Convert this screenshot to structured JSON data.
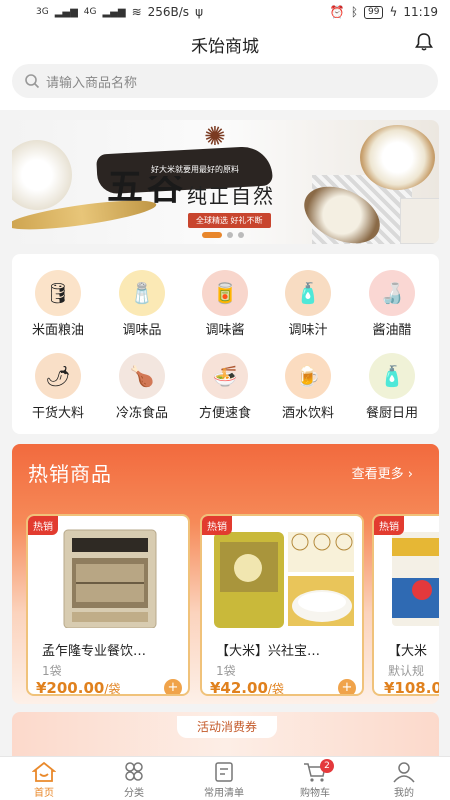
{
  "status": {
    "signal1": "3G",
    "signal2": "4G",
    "speed": "256B/s",
    "battery": "99",
    "time": "11:19"
  },
  "header": {
    "title": "禾饴商城"
  },
  "search": {
    "placeholder": "请输入商品名称"
  },
  "banner": {
    "big": "五谷",
    "small": "好大米就要用最好的原料",
    "mid": "纯正自然",
    "red": "全球精选 好礼不断"
  },
  "categories": [
    {
      "label": "米面粮油",
      "icon": "rice-oil-icon",
      "color": "#fbe3c9"
    },
    {
      "label": "调味品",
      "icon": "seasoning-icon",
      "color": "#fbe9b5"
    },
    {
      "label": "调味酱",
      "icon": "sauce-icon",
      "color": "#f8d6cc"
    },
    {
      "label": "调味汁",
      "icon": "juice-icon",
      "color": "#f8dcc2"
    },
    {
      "label": "酱油醋",
      "icon": "soy-vinegar-icon",
      "color": "#fad7d3"
    },
    {
      "label": "干货大料",
      "icon": "dried-goods-icon",
      "color": "#f9dfc7"
    },
    {
      "label": "冷冻食品",
      "icon": "frozen-food-icon",
      "color": "#f3e6df"
    },
    {
      "label": "方便速食",
      "icon": "instant-food-icon",
      "color": "#f7e2d8"
    },
    {
      "label": "酒水饮料",
      "icon": "drinks-icon",
      "color": "#fbdcc0"
    },
    {
      "label": "餐厨日用",
      "icon": "kitchen-daily-icon",
      "color": "#f0f2d7"
    }
  ],
  "hot": {
    "title": "热销商品",
    "more": "查看更多 ›",
    "items": [
      {
        "tag": "热销",
        "name": "孟乍隆专业餐饮…",
        "unit": "1袋",
        "price": "¥200.00",
        "per": "/袋",
        "add": "+"
      },
      {
        "tag": "热销",
        "name": "【大米】兴社宝…",
        "unit": "1袋",
        "price": "¥42.00",
        "per": "/袋",
        "add": "+"
      },
      {
        "tag": "热销",
        "name": "【大米",
        "unit": "默认规",
        "price": "¥108.0",
        "per": "",
        "add": ""
      }
    ]
  },
  "coupon": {
    "label": "活动消费券"
  },
  "tabs": [
    {
      "label": "首页"
    },
    {
      "label": "分类"
    },
    {
      "label": "常用清单"
    },
    {
      "label": "购物车",
      "badge": "2"
    },
    {
      "label": "我的"
    }
  ],
  "colors": {
    "accent": "#e9892b",
    "hot": "#f26a3e",
    "price": "#e0811e"
  }
}
